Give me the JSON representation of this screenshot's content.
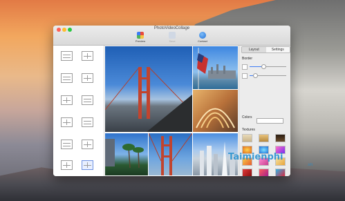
{
  "window": {
    "title": "PhotoVideoCollage"
  },
  "toolbar": {
    "preview_label": "Preview",
    "save_label": "Save",
    "contact_label": "Contact"
  },
  "panel": {
    "tabs": [
      {
        "label": "Layout"
      },
      {
        "label": "Settings"
      }
    ],
    "border_label": "Border",
    "colors_label": "Colors",
    "textures_label": "Textures",
    "border_value": 0.35,
    "spacing_value": 0.15
  },
  "watermark": {
    "text": "Taimienphi",
    "sub": ".vn"
  },
  "colors": {
    "accent": "#3d7cf5",
    "selected_layout": "#6b8fe0"
  }
}
